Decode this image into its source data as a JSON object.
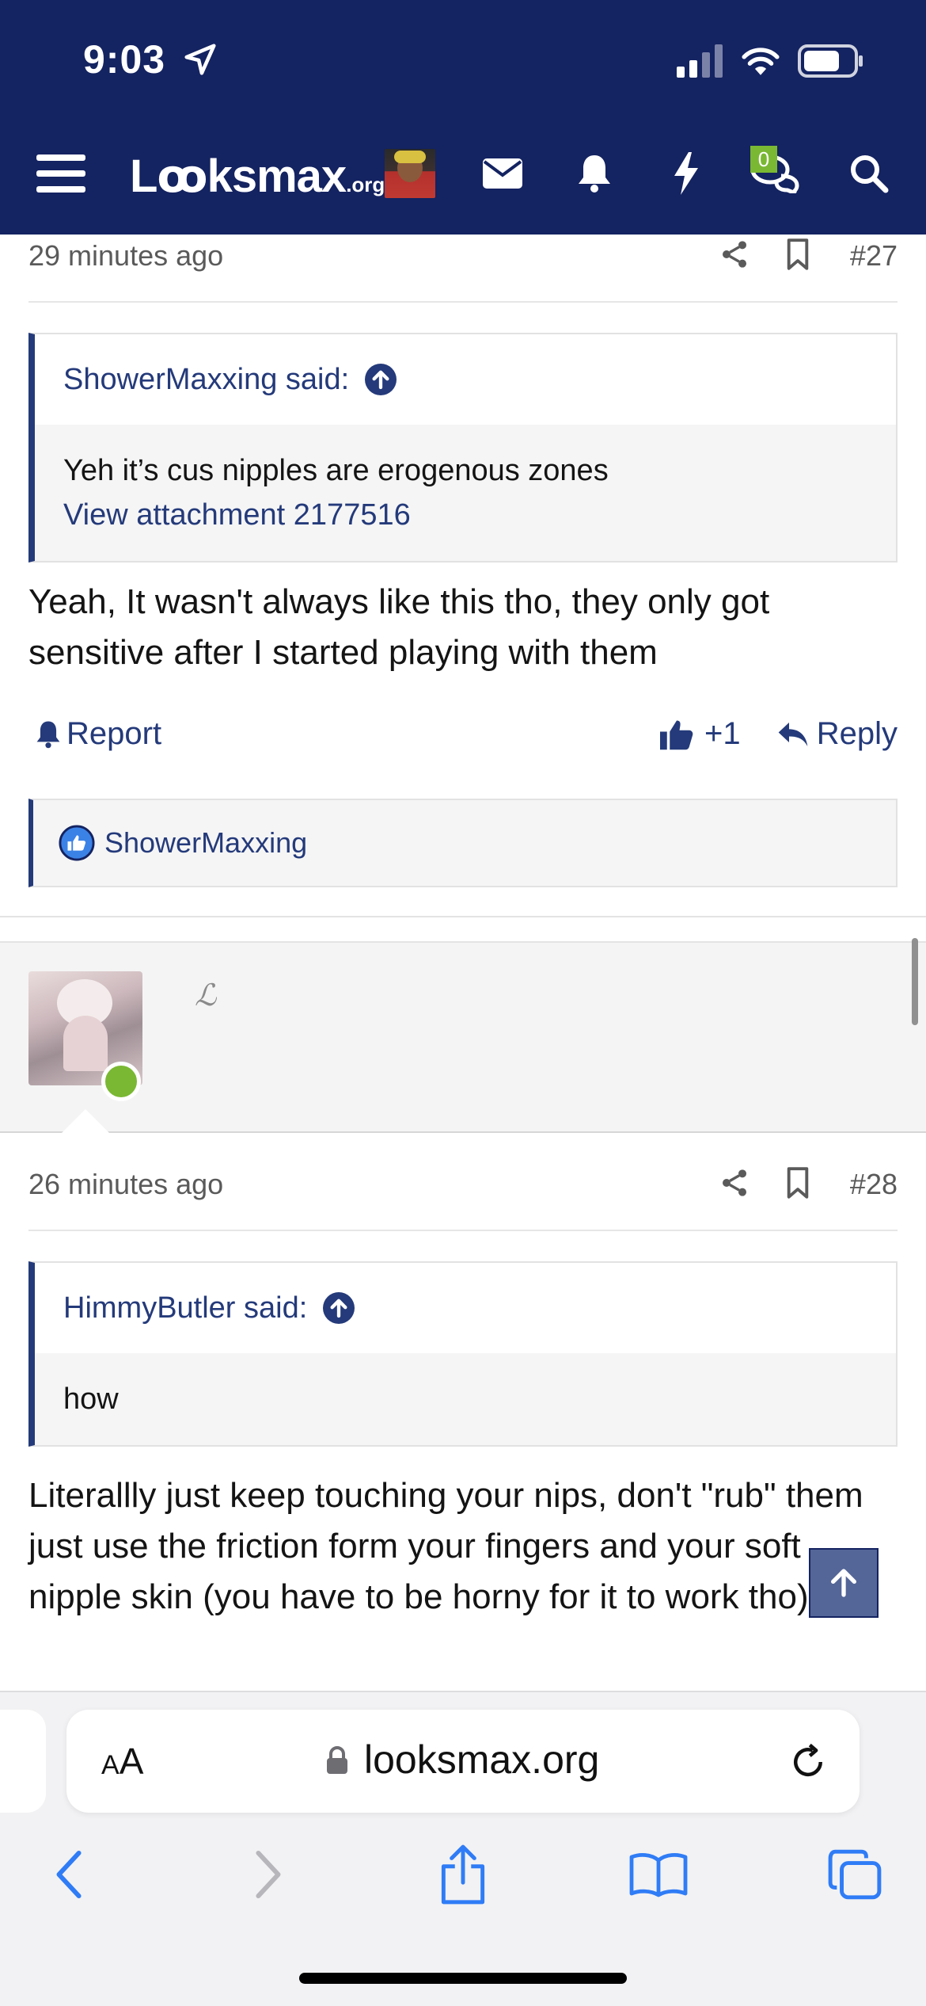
{
  "status_bar": {
    "time": "9:03"
  },
  "header": {
    "logo_main": "Lꝏksmax",
    "logo_suffix": ".org",
    "conversations_badge": "0"
  },
  "posts": [
    {
      "time_ago": "29 minutes ago",
      "number": "#27",
      "quote": {
        "author_label": "ShowerMaxxing said:",
        "text": "Yeh it’s cus nipples are erogenous zones",
        "attachment_link": "View attachment 2177516"
      },
      "body": "Yeah, It wasn't always like this tho, they only got sensitive after I started playing with them",
      "actions": {
        "report": "Report",
        "like": "+1",
        "reply": "Reply"
      },
      "reactions": {
        "user": "ShowerMaxxing"
      }
    },
    {
      "rank_glyph": "ℒ",
      "time_ago": "26 minutes ago",
      "number": "#28",
      "quote": {
        "author_label": "HimmyButler said:",
        "text": "how"
      },
      "body": "Literallly just keep touching your nips, don't \"rub\" them just use the friction form your fingers and your soft nipple skin (you have to be horny for it to work tho)"
    }
  ],
  "browser": {
    "text_size_label_small": "A",
    "text_size_label_large": "A",
    "url": "looksmax.org"
  },
  "colors": {
    "brand_navy": "#142361",
    "link_blue": "#243a7a",
    "online_green": "#7ab833"
  }
}
